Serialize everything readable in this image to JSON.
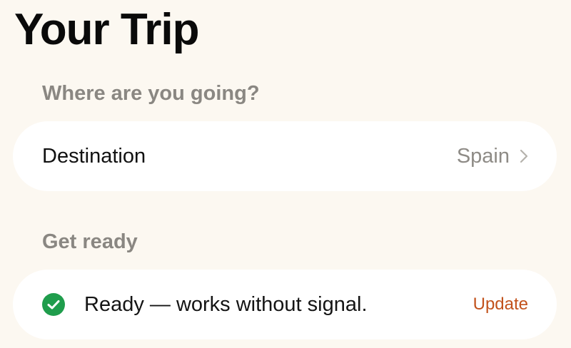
{
  "page": {
    "title": "Your Trip"
  },
  "destination_section": {
    "header": "Where are you going?",
    "row": {
      "label": "Destination",
      "value": "Spain",
      "icon": "chevron-right-icon"
    }
  },
  "ready_section": {
    "header": "Get ready",
    "status": {
      "icon": "check-circle-icon",
      "text": "Ready — works without signal.",
      "action_label": "Update"
    }
  },
  "colors": {
    "background": "#fcf8f1",
    "card": "#ffffff",
    "success": "#1f9d4c",
    "accent": "#c2521c"
  }
}
